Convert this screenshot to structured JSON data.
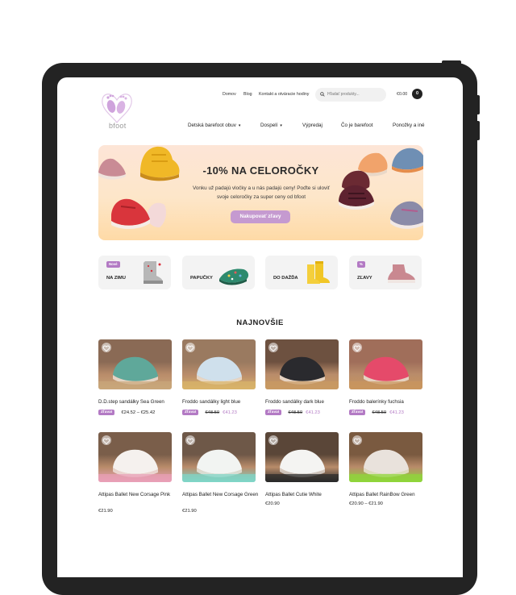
{
  "header": {
    "logo_text": "bfoot",
    "top_links": [
      "Domov",
      "Blog",
      "Kontakt a otváracie hodiny"
    ],
    "search_placeholder": "Hľadať produkty...",
    "cart_total": "€0.00",
    "cart_count": "0",
    "main_nav": [
      {
        "label": "Detská barefoot obuv",
        "dropdown": true
      },
      {
        "label": "Dospelí",
        "dropdown": true
      },
      {
        "label": "Výpredaj",
        "dropdown": false
      },
      {
        "label": "Čo je barefoot",
        "dropdown": false
      },
      {
        "label": "Ponožky a iné",
        "dropdown": false
      }
    ]
  },
  "hero": {
    "title": "-10% NA CELOROČKY",
    "text": "Vonku už padajú vločky a u nás padajú ceny! Poďte si uloviť svoje celoročky za super ceny od bfoot",
    "button": "Nakupovať zľavy"
  },
  "categories": [
    {
      "label": "NA ZIMU",
      "badge": "Nové"
    },
    {
      "label": "PAPUČKY",
      "badge": ""
    },
    {
      "label": "DO DAŽĎA",
      "badge": ""
    },
    {
      "label": "ZĽAVY",
      "badge": "%"
    }
  ],
  "section_title": "NAJNOVŠIE",
  "products": [
    {
      "name": "D.D.step sandálky Sea Green",
      "badge": "Zľava!",
      "old_price": "",
      "new_price": "",
      "price": "€24.52 – €25.42"
    },
    {
      "name": "Froddo sandálky light blue",
      "badge": "Zľava!",
      "old_price": "€48.50",
      "new_price": "€41.23",
      "price": ""
    },
    {
      "name": "Froddo sandálky dark blue",
      "badge": "Zľava!",
      "old_price": "€48.50",
      "new_price": "€41.23",
      "price": ""
    },
    {
      "name": "Froddo balerínky fuchsia",
      "badge": "Zľava!",
      "old_price": "€48.50",
      "new_price": "€41.23",
      "price": ""
    },
    {
      "name": "Attipas Ballet New Corsage Pink",
      "badge": "",
      "old_price": "",
      "new_price": "",
      "price": "€21.90"
    },
    {
      "name": "Attipas Ballet New Corsage Green",
      "badge": "",
      "old_price": "",
      "new_price": "",
      "price": "€21.90"
    },
    {
      "name": "Attipas Ballet Cutie White",
      "badge": "",
      "old_price": "",
      "new_price": "",
      "price": "€20.90"
    },
    {
      "name": "Attipas Ballet RainBow Green",
      "badge": "",
      "old_price": "",
      "new_price": "",
      "price": "€20.90 – €21.90"
    }
  ],
  "colors": {
    "accent": "#b37ac4",
    "button": "#c59ad0",
    "frame": "#232323",
    "hero_gradient_top": "#fde5d7",
    "hero_gradient_bottom": "#fedaa6"
  }
}
